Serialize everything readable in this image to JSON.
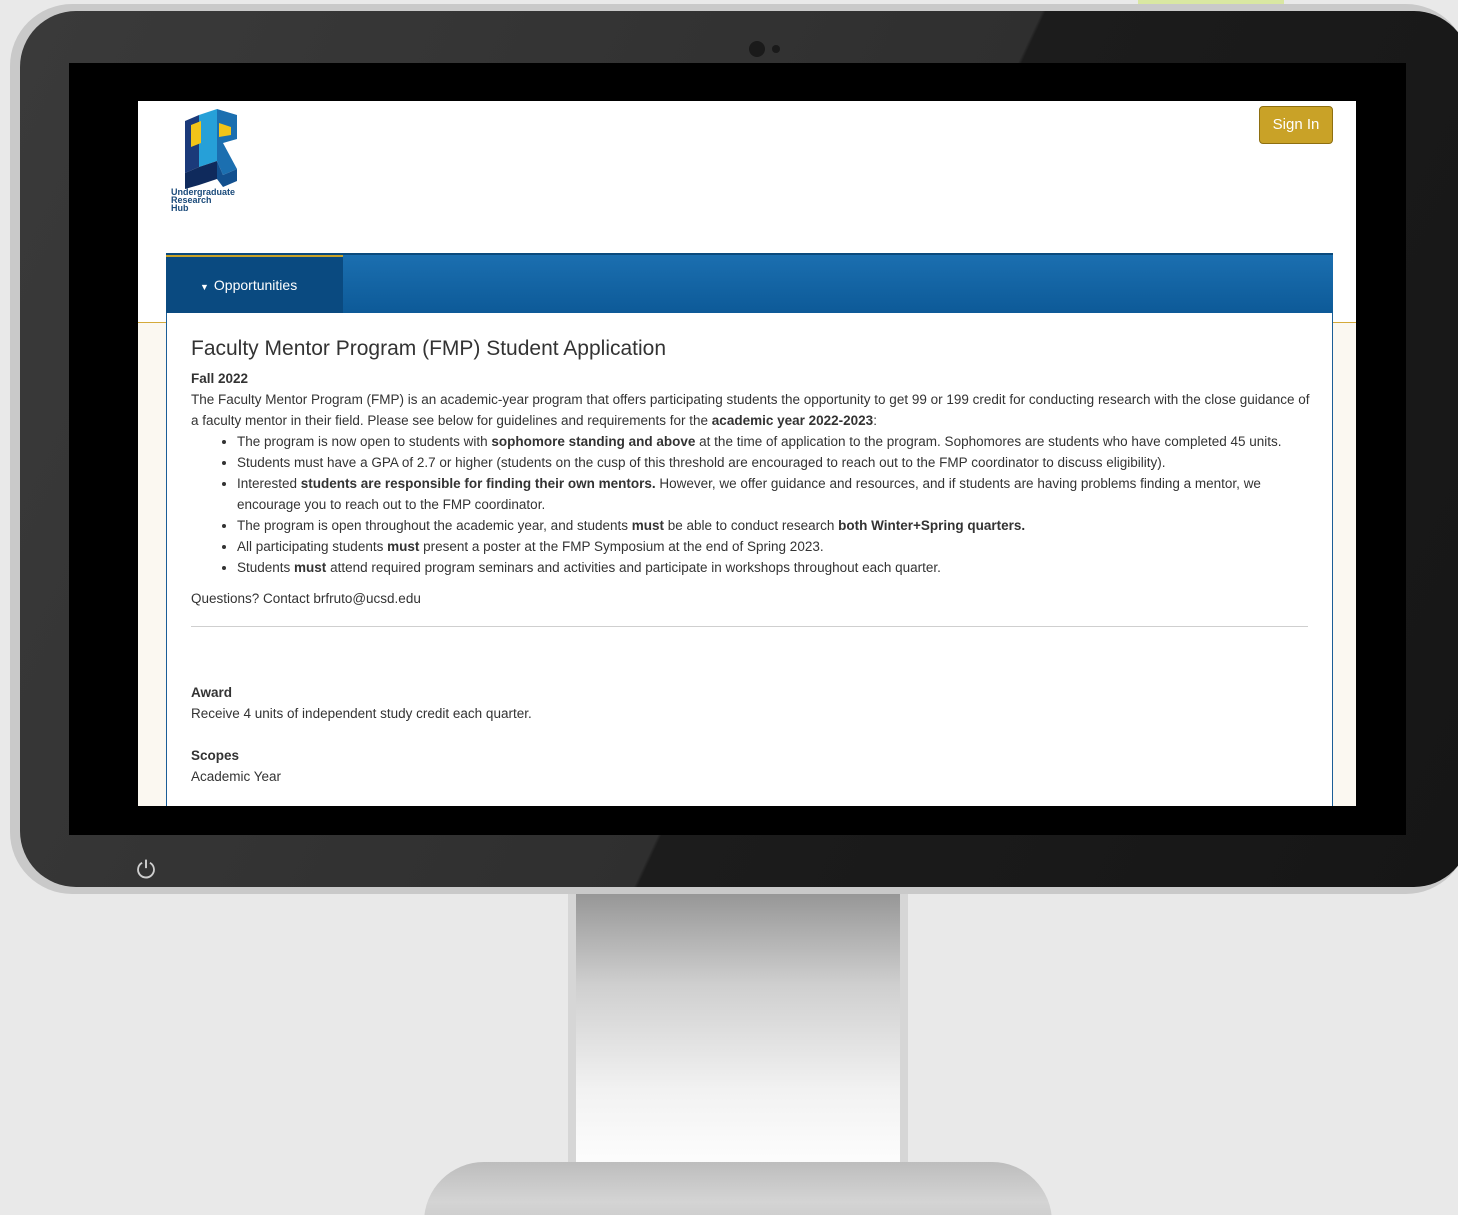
{
  "header": {
    "logo_alt": "Undergraduate Research Hub",
    "logo_lines": [
      "Undergraduate",
      "Research",
      "Hub"
    ],
    "signin_label": "Sign In"
  },
  "nav": {
    "tab_label": "Opportunities"
  },
  "page": {
    "title": "Faculty Mentor Program (FMP) Student Application",
    "term": "Fall 2022",
    "intro_1": "The Faculty Mentor Program (FMP) is an academic-year program that offers participating students the opportunity to get 99 or 199 credit for conducting research with the close guidance of a faculty mentor in their field. Please see below for guidelines and requirements for the ",
    "intro_bold": "academic year 2022-2023",
    "intro_2": ":",
    "bullets": [
      {
        "a": "The program is now open to students with ",
        "b": "sophomore standing and above",
        "c": " at the time of application to the program. Sophomores are students who have completed 45 units."
      },
      {
        "a": "Students must have a GPA of 2.7 or higher (students on the cusp of this threshold are encouraged to reach out to the FMP coordinator to discuss eligibility).",
        "b": "",
        "c": ""
      },
      {
        "a": "Interested ",
        "b": "students are responsible for finding their own mentors.",
        "c": " However, we offer guidance and resources, and if students are having problems finding a mentor, we encourage you to reach out to the FMP coordinator."
      },
      {
        "a": "The program is open throughout the academic year, and students ",
        "b": "must",
        "c": " be able to conduct research ",
        "d": "both Winter+Spring quarters."
      },
      {
        "a": "All participating students ",
        "b": "must",
        "c": " present a poster at the FMP Symposium at the end of Spring 2023."
      },
      {
        "a": "Students ",
        "b": "must",
        "c": " attend required program seminars and activities and participate in workshops throughout each quarter."
      }
    ],
    "questions": "Questions? Contact brfruto@ucsd.edu",
    "award_label": "Award",
    "award_value": "Receive 4 units of independent study credit each quarter.",
    "scopes_label": "Scopes",
    "scopes_value": "Academic Year"
  },
  "colors": {
    "nav_blue": "#0d5a98",
    "nav_tab": "#0a4a80",
    "signin_gold": "#c9a227",
    "accent_gold": "#d4aa3a"
  },
  "icons": {
    "power": "power-icon",
    "nav_caret": "caret-down-icon"
  }
}
